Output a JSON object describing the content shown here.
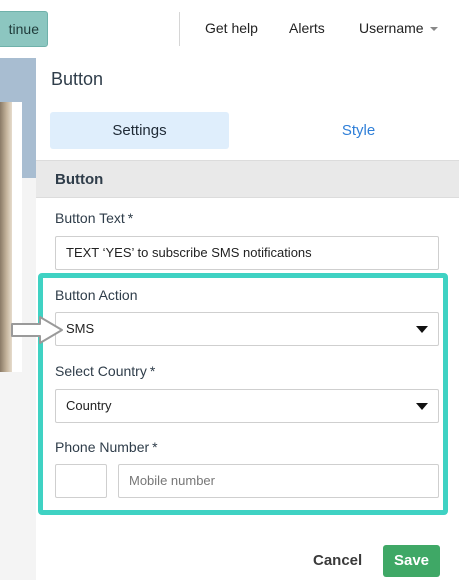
{
  "topbar": {
    "continue_label": "tinue",
    "help_label": "Get help",
    "alerts_label": "Alerts",
    "username_label": "Username"
  },
  "panel": {
    "title": "Button",
    "tabs": [
      {
        "label": "Settings"
      },
      {
        "label": "Style"
      }
    ],
    "section_title": "Button"
  },
  "form": {
    "button_text": {
      "label": "Button Text",
      "required_mark": "*",
      "value": "TEXT ‘YES’ to subscribe SMS notifications"
    },
    "button_action": {
      "label": "Button Action",
      "selected": "SMS"
    },
    "select_country": {
      "label": "Select Country",
      "required_mark": "*",
      "selected": "Country"
    },
    "phone_number": {
      "label": "Phone Number",
      "required_mark": "*",
      "code_value": "",
      "placeholder": "Mobile number"
    }
  },
  "actions": {
    "cancel_label": "Cancel",
    "save_label": "Save"
  },
  "colors": {
    "accent_teal": "#3fd2c3",
    "save_green": "#3fa866",
    "tab_active_bg": "#dfeefc",
    "link_blue": "#2f7fd8"
  },
  "icons": {
    "caret": "caret-down-icon",
    "select_arrow": "triangle-down-icon",
    "pointer": "pointer-arrow-icon"
  }
}
